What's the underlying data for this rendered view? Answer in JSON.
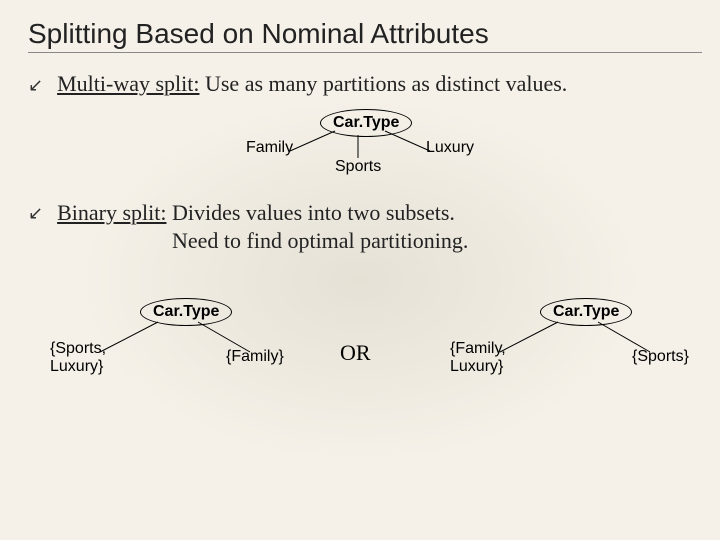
{
  "title": "Splitting Based on Nominal Attributes",
  "bullets": {
    "multi": {
      "label": "Multi-way split:",
      "text": " Use as many partitions as distinct values."
    },
    "binary": {
      "label": "Binary split:",
      "text1": "  Divides values into two subsets.",
      "text2": "Need to find optimal partitioning."
    }
  },
  "diagram": {
    "node": "Car.Type",
    "multi": {
      "left": "Family",
      "mid": "Sports",
      "right": "Luxury"
    },
    "binary": {
      "left": {
        "l": "{Sports,\nLuxury}",
        "r": "{Family}"
      },
      "right": {
        "l": "{Family,\nLuxury}",
        "r": "{Sports}"
      }
    },
    "or": "OR"
  }
}
